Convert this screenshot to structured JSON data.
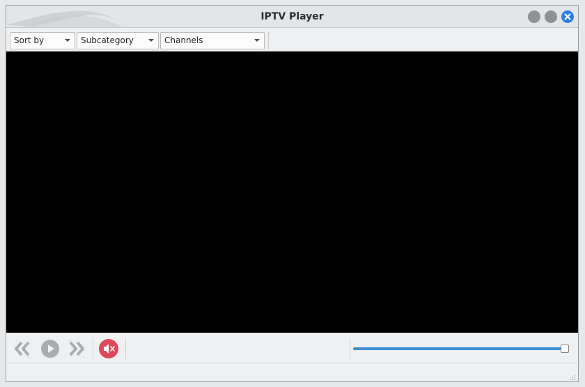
{
  "window": {
    "title": "IPTV Player"
  },
  "toolbar": {
    "sort_label": "Sort by",
    "subcategory_label": "Subcategory",
    "channels_label": "Channels"
  },
  "controls": {
    "volume_level": 1.0,
    "muted": true
  },
  "colors": {
    "close_button": "#2f7fe0",
    "mute_button": "#dc4a5a",
    "slider_fill": "#3d8fcf",
    "video_background": "#000000"
  },
  "icons": {
    "previous": "double-chevron-left-icon",
    "play": "play-icon",
    "next": "double-chevron-right-icon",
    "mute": "speaker-muted-icon"
  }
}
